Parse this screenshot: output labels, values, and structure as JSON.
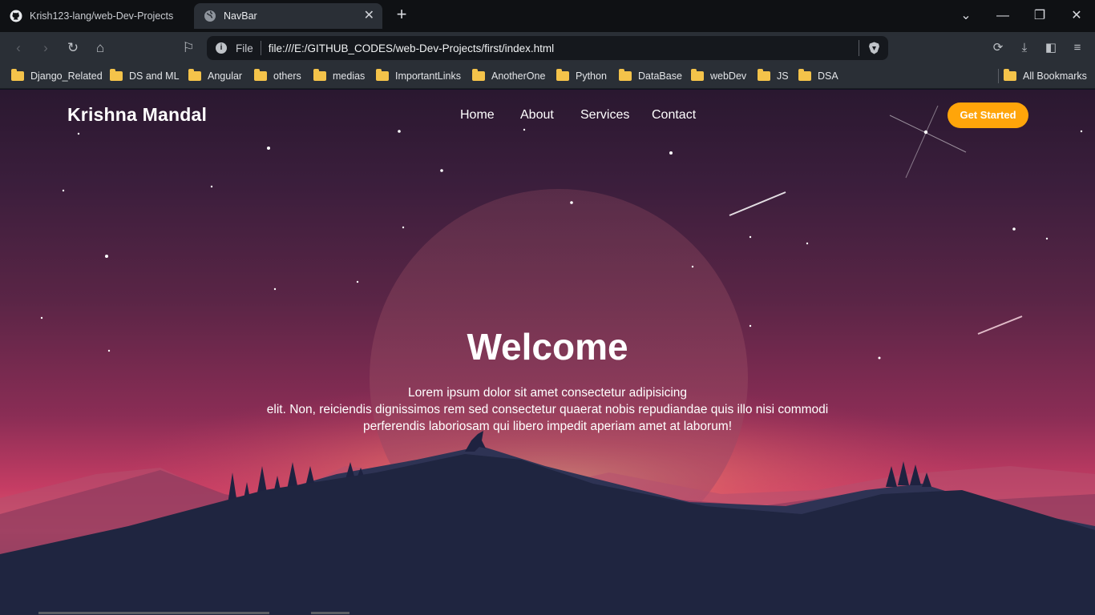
{
  "tabs": [
    {
      "title": "Krish123-lang/web-Dev-Projects",
      "favicon": "github-icon",
      "active": false
    },
    {
      "title": "NavBar",
      "favicon": "globe-icon",
      "active": true
    }
  ],
  "toolbar": {
    "scheme_label": "File",
    "url": "file:///E:/GITHUB_CODES/web-Dev-Projects/first/index.html"
  },
  "bookmarks": {
    "items": [
      "Django_Related",
      "DS and ML",
      "Angular",
      "others",
      "medias",
      "ImportantLinks",
      "AnotherOne",
      "Python",
      "DataBase",
      "webDev",
      "JS",
      "DSA"
    ],
    "all_label": "All Bookmarks"
  },
  "site": {
    "brand": "Krishna Mandal",
    "nav": [
      "Home",
      "About",
      "Services",
      "Contact"
    ],
    "cta_label": "Get Started",
    "hero_title": "Welcome",
    "hero_lines": [
      "Lorem ipsum dolor sit amet consectetur adipisicing",
      "elit. Non, reiciendis dignissimos rem sed consectetur quaerat nobis repudiandae quis illo nisi commodi",
      "perferendis laboriosam qui libero impedit aperiam amet at laborum!"
    ]
  },
  "colors": {
    "cta": "#ffa50a",
    "toolbar": "#2a2f36",
    "folder": "#f4c34a"
  }
}
